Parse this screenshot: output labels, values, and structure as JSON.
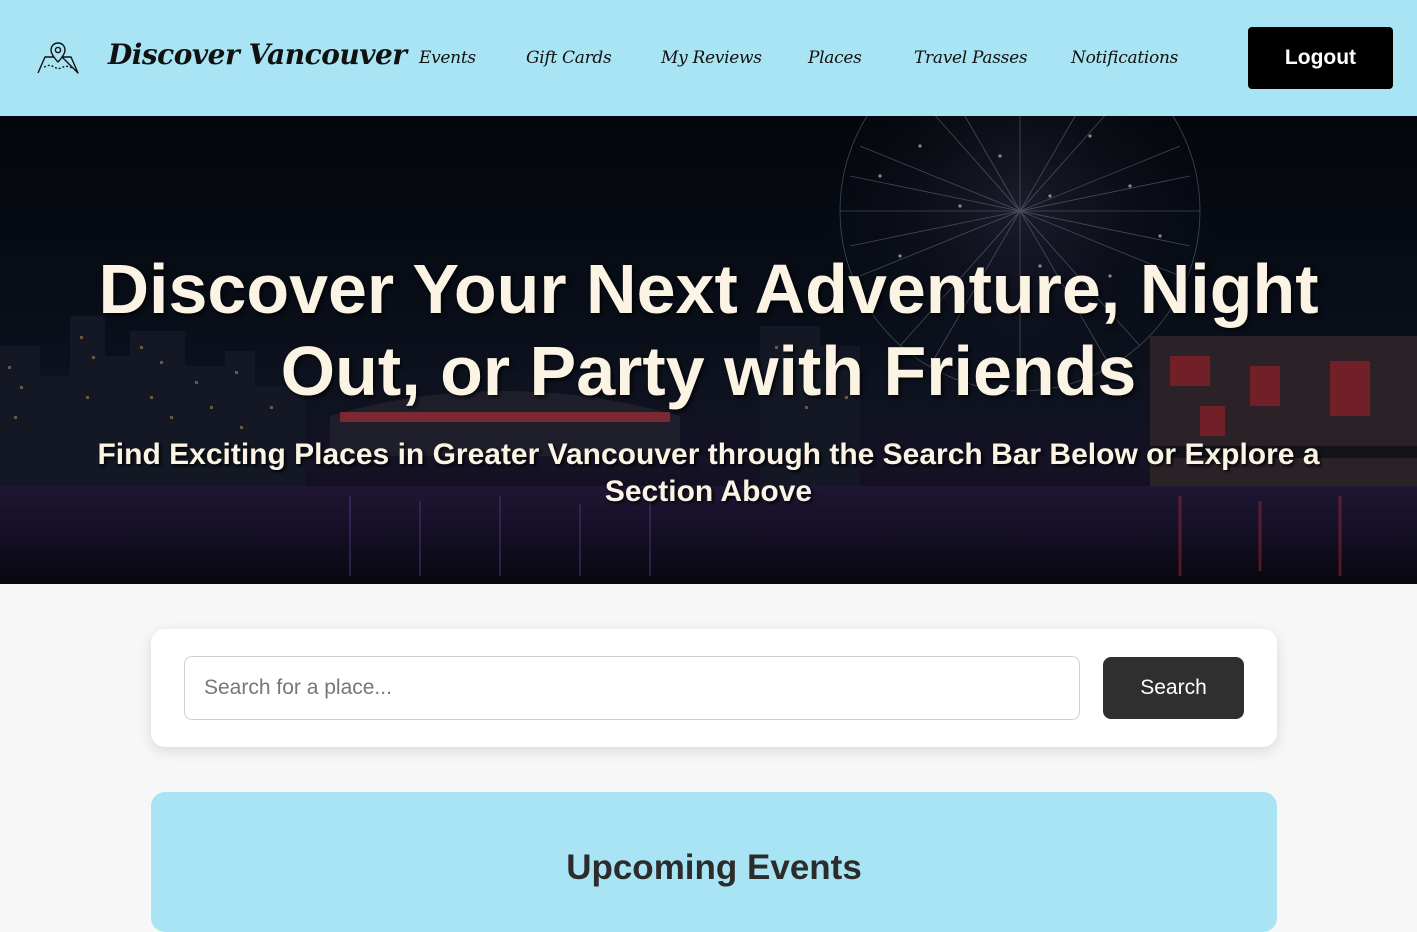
{
  "brand": {
    "logo_icon": "map-pin-icon",
    "name": "Discover Vancouver"
  },
  "nav": {
    "items": [
      {
        "label": "Events"
      },
      {
        "label": "Gift Cards"
      },
      {
        "label": "My Reviews"
      },
      {
        "label": "Places"
      },
      {
        "label": "Travel Passes"
      },
      {
        "label": "Notifications"
      }
    ],
    "logout_label": "Logout"
  },
  "hero": {
    "title": "Discover Your Next Adventure, Night Out, or Party with Friends",
    "subtitle": "Find Exciting Places in Greater Vancouver through the Search Bar Below or Explore a Section Above"
  },
  "search": {
    "placeholder": "Search for a place...",
    "value": "",
    "button_label": "Search"
  },
  "events": {
    "title": "Upcoming Events"
  },
  "colors": {
    "nav_bg": "#a8e4f3",
    "hero_text": "#fbf3e4",
    "logout_bg": "#000000",
    "search_btn_bg": "#2f2f2f",
    "page_bg": "#f7f7f7"
  }
}
